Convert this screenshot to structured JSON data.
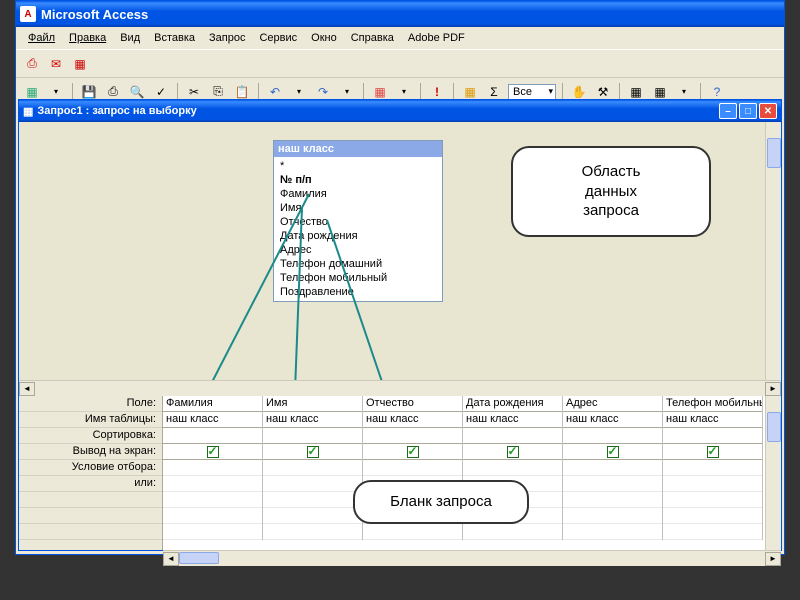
{
  "app": {
    "title": "Microsoft Access"
  },
  "menu": [
    "Файл",
    "Правка",
    "Вид",
    "Вставка",
    "Запрос",
    "Сервис",
    "Окно",
    "Справка",
    "Adobe PDF"
  ],
  "toolbar_combo": "Все",
  "child": {
    "title": "Запрос1 : запрос на выборку"
  },
  "table_box": {
    "title": "наш класс",
    "fields": [
      "*",
      "№ п/п",
      "Фамилия",
      "Имя",
      "Отчество",
      "Дата рождения",
      "Адрес",
      "Телефон домашний",
      "Телефон мобильный",
      "Поздравление"
    ]
  },
  "callout1": "Область\nданных\nзапроса",
  "callout2": "Бланк запроса",
  "grid": {
    "row_labels": [
      "Поле:",
      "Имя таблицы:",
      "Сортировка:",
      "Вывод на экран:",
      "Условие отбора:",
      "или:",
      "",
      "",
      ""
    ],
    "columns": [
      {
        "field": "Фамилия",
        "table": "наш класс",
        "show": true
      },
      {
        "field": "Имя",
        "table": "наш класс",
        "show": true
      },
      {
        "field": "Отчество",
        "table": "наш класс",
        "show": true
      },
      {
        "field": "Дата рождения",
        "table": "наш класс",
        "show": true
      },
      {
        "field": "Адрес",
        "table": "наш класс",
        "show": true
      },
      {
        "field": "Телефон мобильны",
        "table": "наш класс",
        "show": true
      }
    ]
  }
}
